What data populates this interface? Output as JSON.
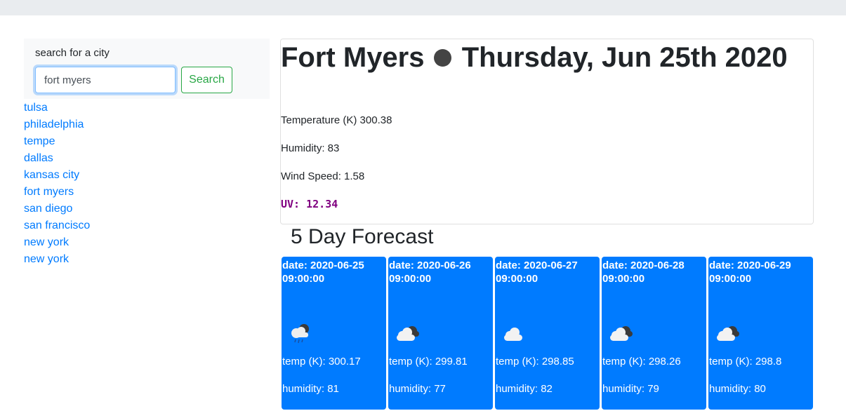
{
  "sidebar": {
    "search_label": "search for a city",
    "search_value": "fort myers",
    "search_button": "Search",
    "history": [
      "tulsa",
      "philadelphia",
      "tempe",
      "dallas",
      "kansas city",
      "fort myers",
      "san diego",
      "san francisco",
      "new york",
      "new york"
    ]
  },
  "current": {
    "city": "Fort Myers",
    "date": "Thursday, Jun 25th 2020",
    "temperature": "Temperature (K) 300.38",
    "humidity": "Humidity: 83",
    "wind": "Wind Speed: 1.58",
    "uv": "UV: 12.34",
    "icon": "dark-circle-icon",
    "uv_color": "#800080"
  },
  "forecast": {
    "title": "5 Day Forecast",
    "card_color": "#007bff",
    "days": [
      {
        "date": "date: 2020-06-25 09:00:00",
        "temp": "temp (K): 300.17",
        "humidity": "humidity: 81",
        "icon": "rain-cloud-icon"
      },
      {
        "date": "date: 2020-06-26 09:00:00",
        "temp": "temp (K): 299.81",
        "humidity": "humidity: 77",
        "icon": "broken-clouds-icon"
      },
      {
        "date": "date: 2020-06-27 09:00:00",
        "temp": "temp (K): 298.85",
        "humidity": "humidity: 82",
        "icon": "cloud-icon"
      },
      {
        "date": "date: 2020-06-28 09:00:00",
        "temp": "temp (K): 298.26",
        "humidity": "humidity: 79",
        "icon": "broken-clouds-icon"
      },
      {
        "date": "date: 2020-06-29 09:00:00",
        "temp": "temp (K): 298.8",
        "humidity": "humidity: 80",
        "icon": "broken-clouds-icon"
      }
    ]
  }
}
